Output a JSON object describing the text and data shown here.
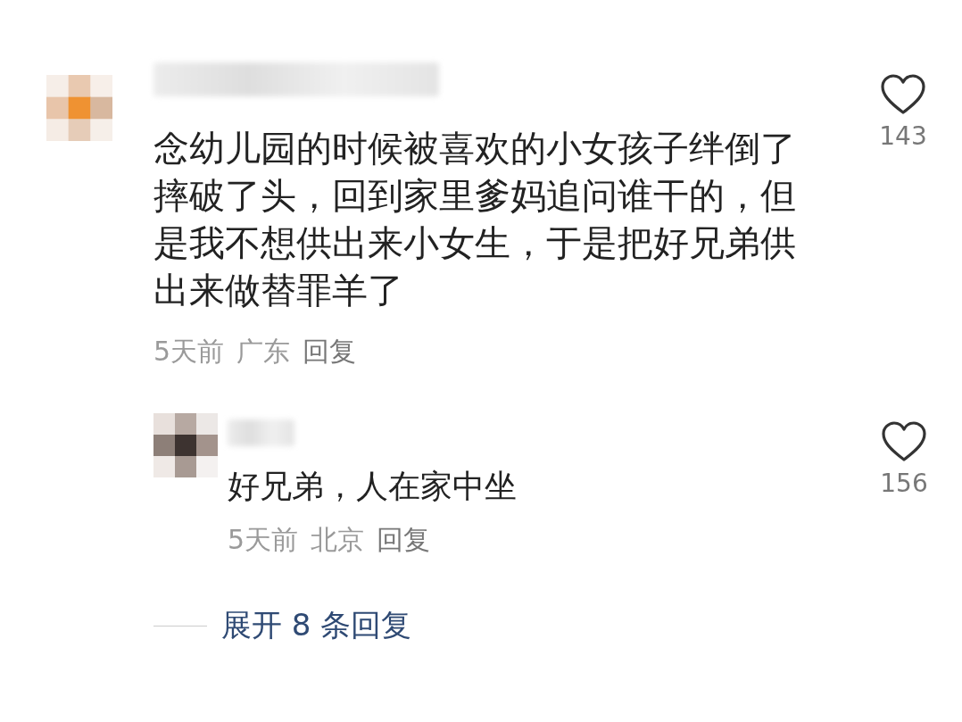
{
  "comment": {
    "text": "念幼儿园的时候被喜欢的小女孩子绊倒了摔破了头，回到家里爹妈追问谁干的，但是我不想供出来小女生，于是把好兄弟供出来做替罪羊了",
    "time": "5天前",
    "location": "广东",
    "reply_label": "回复",
    "like_count": "143",
    "replies": [
      {
        "text": "好兄弟，人在家中坐",
        "time": "5天前",
        "location": "北京",
        "reply_label": "回复",
        "like_count": "156"
      }
    ],
    "expand_label": "展开 8 条回复"
  }
}
